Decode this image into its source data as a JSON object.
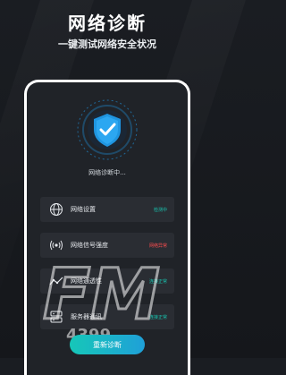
{
  "header": {
    "title": "网络诊断",
    "subtitle": "一键测试网络安全状况"
  },
  "scan": {
    "status_text": "网络诊断中..."
  },
  "rows": [
    {
      "label": "网络设置",
      "status": "检测中",
      "status_color": "#18c4b0",
      "icon": "globe-icon"
    },
    {
      "label": "网络信号强度",
      "status": "网络异常",
      "status_color": "#ff4d4f",
      "icon": "signal-icon"
    },
    {
      "label": "网络通透性",
      "status": "连接正常",
      "status_color": "#18c4b0",
      "icon": "line-chart-icon"
    },
    {
      "label": "服务器通讯",
      "status": "连接正常",
      "status_color": "#18c4b0",
      "icon": "server-icon"
    }
  ],
  "button": {
    "label": "重新诊断"
  },
  "watermark": {
    "big": "FM",
    "small": "4399"
  },
  "colors": {
    "accent": "#18c4b0",
    "shield": "#1f95e0"
  }
}
